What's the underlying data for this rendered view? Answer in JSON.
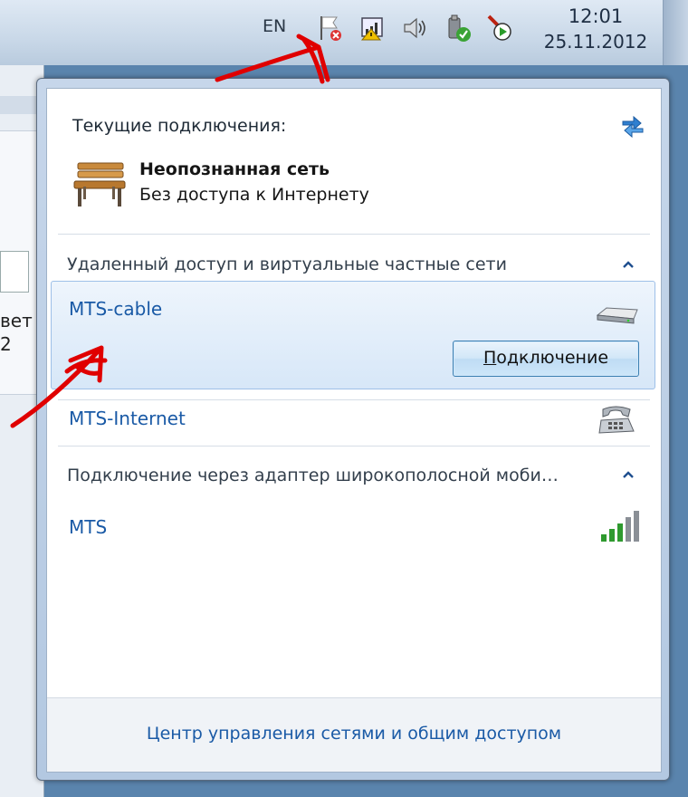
{
  "taskbar": {
    "language": "EN",
    "time": "12:01",
    "date": "25.11.2012",
    "tray_icons": [
      "flag-icon",
      "network-icon",
      "volume-icon",
      "usb-icon",
      "media-icon"
    ]
  },
  "background_window": {
    "fragments": [
      "вет",
      "2"
    ]
  },
  "flyout": {
    "current_label": "Текущие подключения:",
    "current_network": {
      "name": "Неопознанная сеть",
      "status": "Без доступа к Интернету",
      "icon": "bench-icon"
    },
    "section_vpn": {
      "title": "Удаленный доступ и виртуальные частные сети",
      "items": [
        {
          "label": "MTS-cable",
          "icon": "modem-icon",
          "selected": true,
          "button": "Подключение",
          "button_accesskey": "П"
        },
        {
          "label": "MTS-Internet",
          "icon": "phone-icon"
        }
      ]
    },
    "section_mobile": {
      "title": "Подключение через адаптер широкополосной моби…",
      "items": [
        {
          "label": "MTS",
          "icon": "signal-bars-icon",
          "signal_strength": 5
        }
      ]
    },
    "footer_link": "Центр управления сетями и общим доступом"
  },
  "colors": {
    "link": "#1a5aa6",
    "annotation": "#e00000",
    "selection": "#d7e7f8"
  }
}
